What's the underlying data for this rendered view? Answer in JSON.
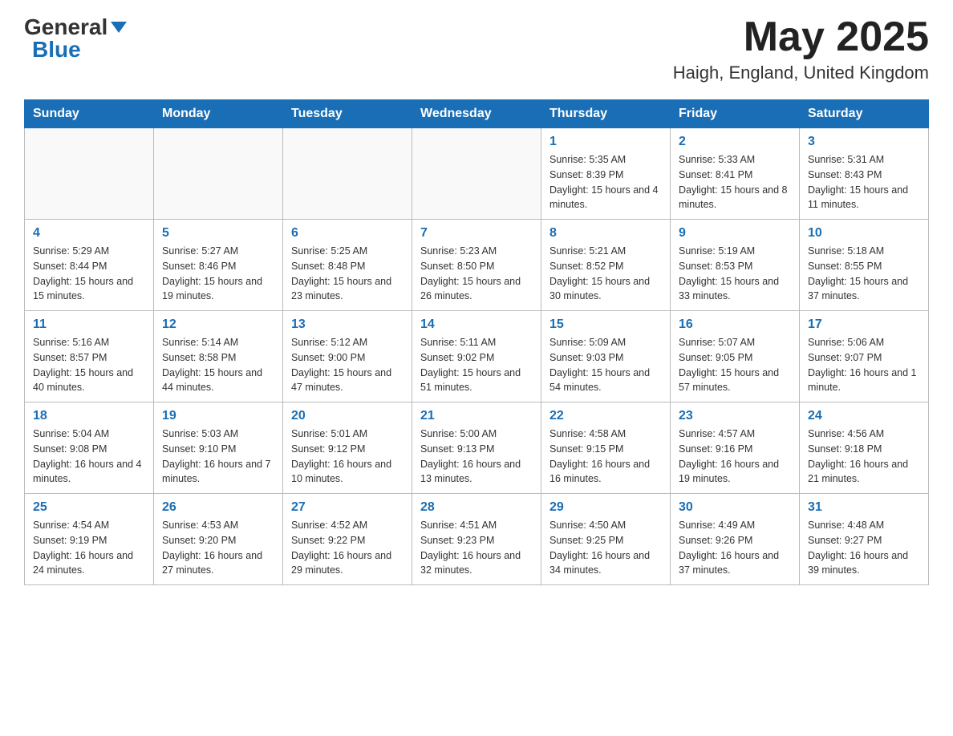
{
  "header": {
    "logo_general": "General",
    "logo_blue": "Blue",
    "month_title": "May 2025",
    "location": "Haigh, England, United Kingdom"
  },
  "days_of_week": [
    "Sunday",
    "Monday",
    "Tuesday",
    "Wednesday",
    "Thursday",
    "Friday",
    "Saturday"
  ],
  "weeks": [
    [
      {
        "day": "",
        "info": ""
      },
      {
        "day": "",
        "info": ""
      },
      {
        "day": "",
        "info": ""
      },
      {
        "day": "",
        "info": ""
      },
      {
        "day": "1",
        "info": "Sunrise: 5:35 AM\nSunset: 8:39 PM\nDaylight: 15 hours and 4 minutes."
      },
      {
        "day": "2",
        "info": "Sunrise: 5:33 AM\nSunset: 8:41 PM\nDaylight: 15 hours and 8 minutes."
      },
      {
        "day": "3",
        "info": "Sunrise: 5:31 AM\nSunset: 8:43 PM\nDaylight: 15 hours and 11 minutes."
      }
    ],
    [
      {
        "day": "4",
        "info": "Sunrise: 5:29 AM\nSunset: 8:44 PM\nDaylight: 15 hours and 15 minutes."
      },
      {
        "day": "5",
        "info": "Sunrise: 5:27 AM\nSunset: 8:46 PM\nDaylight: 15 hours and 19 minutes."
      },
      {
        "day": "6",
        "info": "Sunrise: 5:25 AM\nSunset: 8:48 PM\nDaylight: 15 hours and 23 minutes."
      },
      {
        "day": "7",
        "info": "Sunrise: 5:23 AM\nSunset: 8:50 PM\nDaylight: 15 hours and 26 minutes."
      },
      {
        "day": "8",
        "info": "Sunrise: 5:21 AM\nSunset: 8:52 PM\nDaylight: 15 hours and 30 minutes."
      },
      {
        "day": "9",
        "info": "Sunrise: 5:19 AM\nSunset: 8:53 PM\nDaylight: 15 hours and 33 minutes."
      },
      {
        "day": "10",
        "info": "Sunrise: 5:18 AM\nSunset: 8:55 PM\nDaylight: 15 hours and 37 minutes."
      }
    ],
    [
      {
        "day": "11",
        "info": "Sunrise: 5:16 AM\nSunset: 8:57 PM\nDaylight: 15 hours and 40 minutes."
      },
      {
        "day": "12",
        "info": "Sunrise: 5:14 AM\nSunset: 8:58 PM\nDaylight: 15 hours and 44 minutes."
      },
      {
        "day": "13",
        "info": "Sunrise: 5:12 AM\nSunset: 9:00 PM\nDaylight: 15 hours and 47 minutes."
      },
      {
        "day": "14",
        "info": "Sunrise: 5:11 AM\nSunset: 9:02 PM\nDaylight: 15 hours and 51 minutes."
      },
      {
        "day": "15",
        "info": "Sunrise: 5:09 AM\nSunset: 9:03 PM\nDaylight: 15 hours and 54 minutes."
      },
      {
        "day": "16",
        "info": "Sunrise: 5:07 AM\nSunset: 9:05 PM\nDaylight: 15 hours and 57 minutes."
      },
      {
        "day": "17",
        "info": "Sunrise: 5:06 AM\nSunset: 9:07 PM\nDaylight: 16 hours and 1 minute."
      }
    ],
    [
      {
        "day": "18",
        "info": "Sunrise: 5:04 AM\nSunset: 9:08 PM\nDaylight: 16 hours and 4 minutes."
      },
      {
        "day": "19",
        "info": "Sunrise: 5:03 AM\nSunset: 9:10 PM\nDaylight: 16 hours and 7 minutes."
      },
      {
        "day": "20",
        "info": "Sunrise: 5:01 AM\nSunset: 9:12 PM\nDaylight: 16 hours and 10 minutes."
      },
      {
        "day": "21",
        "info": "Sunrise: 5:00 AM\nSunset: 9:13 PM\nDaylight: 16 hours and 13 minutes."
      },
      {
        "day": "22",
        "info": "Sunrise: 4:58 AM\nSunset: 9:15 PM\nDaylight: 16 hours and 16 minutes."
      },
      {
        "day": "23",
        "info": "Sunrise: 4:57 AM\nSunset: 9:16 PM\nDaylight: 16 hours and 19 minutes."
      },
      {
        "day": "24",
        "info": "Sunrise: 4:56 AM\nSunset: 9:18 PM\nDaylight: 16 hours and 21 minutes."
      }
    ],
    [
      {
        "day": "25",
        "info": "Sunrise: 4:54 AM\nSunset: 9:19 PM\nDaylight: 16 hours and 24 minutes."
      },
      {
        "day": "26",
        "info": "Sunrise: 4:53 AM\nSunset: 9:20 PM\nDaylight: 16 hours and 27 minutes."
      },
      {
        "day": "27",
        "info": "Sunrise: 4:52 AM\nSunset: 9:22 PM\nDaylight: 16 hours and 29 minutes."
      },
      {
        "day": "28",
        "info": "Sunrise: 4:51 AM\nSunset: 9:23 PM\nDaylight: 16 hours and 32 minutes."
      },
      {
        "day": "29",
        "info": "Sunrise: 4:50 AM\nSunset: 9:25 PM\nDaylight: 16 hours and 34 minutes."
      },
      {
        "day": "30",
        "info": "Sunrise: 4:49 AM\nSunset: 9:26 PM\nDaylight: 16 hours and 37 minutes."
      },
      {
        "day": "31",
        "info": "Sunrise: 4:48 AM\nSunset: 9:27 PM\nDaylight: 16 hours and 39 minutes."
      }
    ]
  ]
}
